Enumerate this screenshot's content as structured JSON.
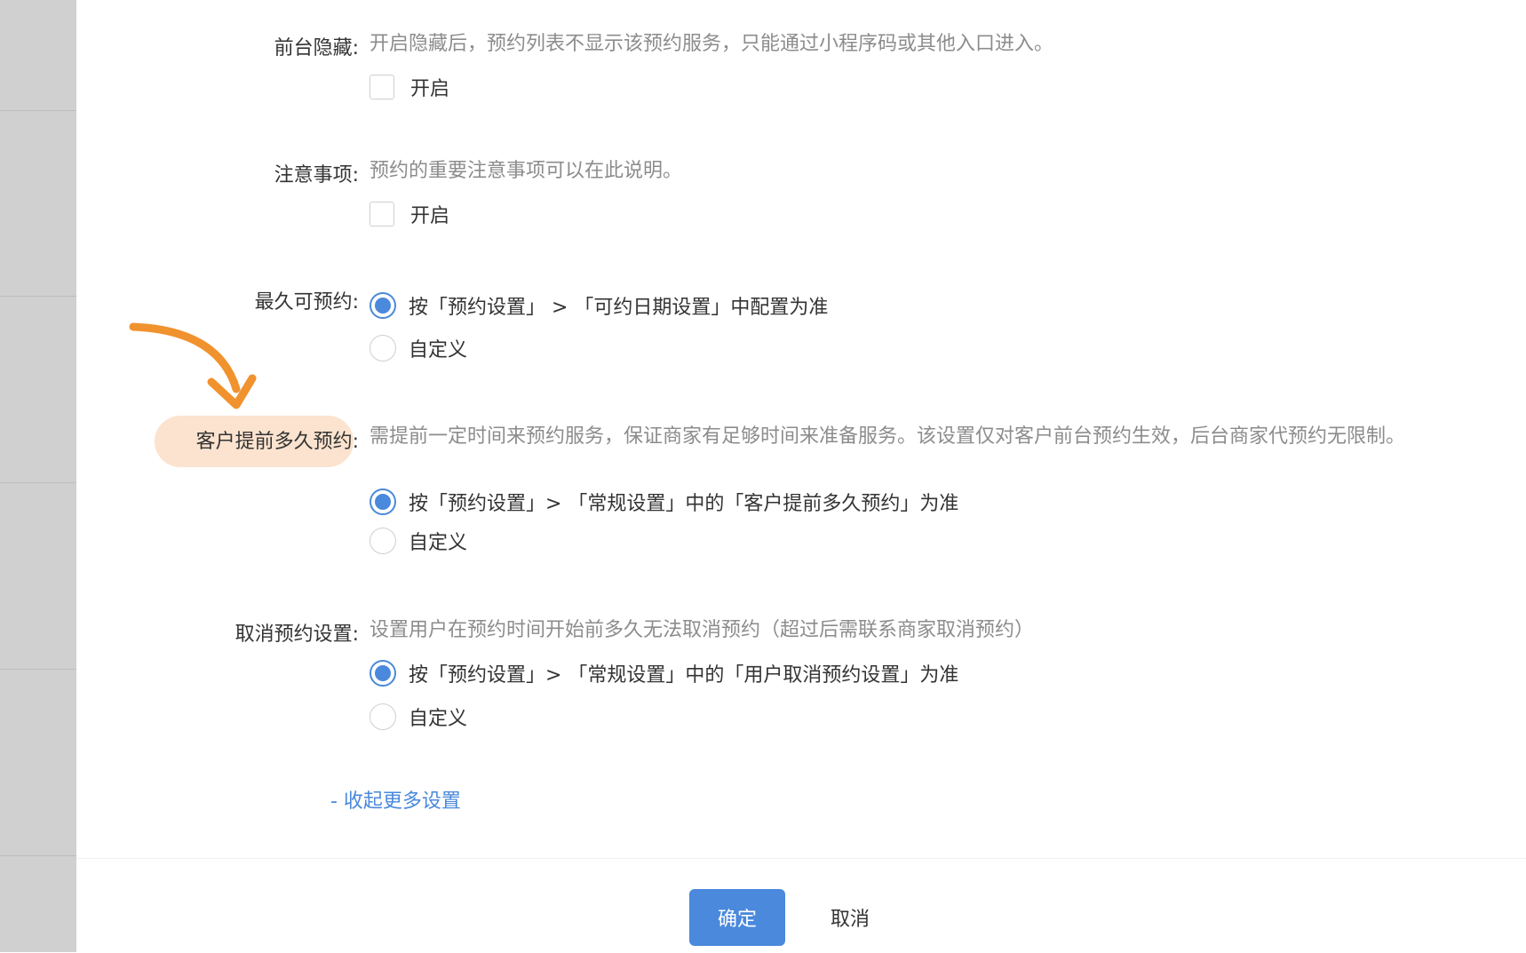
{
  "rows": {
    "hide": {
      "label": "前台隐藏:",
      "desc": "开启隐藏后，预约列表不显示该预约服务，只能通过小程序码或其他入口进入。",
      "checkbox_label": "开启"
    },
    "notes": {
      "label": "注意事项:",
      "desc": "预约的重要注意事项可以在此说明。",
      "checkbox_label": "开启"
    },
    "max_days": {
      "label": "最久可预约:",
      "option1": "按「预约设置」 > 「可约日期设置」中配置为准",
      "option2": "自定义"
    },
    "advance": {
      "label": "客户提前多久预约:",
      "desc": "需提前一定时间来预约服务，保证商家有足够时间来准备服务。该设置仅对客户前台预约生效，后台商家代预约无限制。",
      "option1": "按「预约设置」> 「常规设置」中的「客户提前多久预约」为准",
      "option2": "自定义"
    },
    "cancel": {
      "label": "取消预约设置:",
      "desc": "设置用户在预约时间开始前多久无法取消预约（超过后需联系商家取消预约）",
      "option1": "按「预约设置」> 「常规设置」中的「用户取消预约设置」为准",
      "option2": "自定义"
    }
  },
  "collapse_link": "- 收起更多设置",
  "footer": {
    "confirm": "确定",
    "cancel": "取消"
  },
  "colors": {
    "primary": "#4a89dc",
    "annotation": "#f0922e",
    "highlight": "#fbe3cf"
  }
}
